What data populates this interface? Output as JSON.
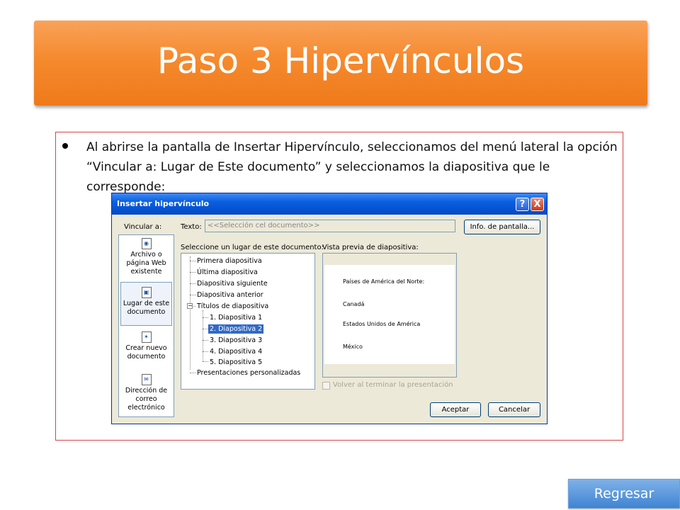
{
  "slide": {
    "title": "Paso 3 Hipervínculos",
    "bullet": "Al abrirse la pantalla de Insertar Hipervínculo, seleccionamos del menú lateral la opción “Vincular a: Lugar de Este documento” y seleccionamos la diapositiva que le corresponde:",
    "back_button": "Regresar"
  },
  "dialog": {
    "title": "Insertar hipervínculo",
    "help_glyph": "?",
    "close_glyph": "X",
    "link_to_label": "Vincular a:",
    "text_label": "Texto:",
    "text_value": "<<Selección cel documento>>",
    "screentip_button": "Info. de pantalla...",
    "select_place_label": "Seleccione un lugar de este documento:",
    "preview_label": "Vista previa de diapositiva:",
    "sidebar": [
      {
        "label": "Archivo o página Web existente",
        "icon": "web-page-icon"
      },
      {
        "label": "Lugar de este documento",
        "icon": "place-in-document-icon",
        "active": true
      },
      {
        "label": "Crear nuevo documento",
        "icon": "new-document-icon"
      },
      {
        "label": "Dirección de correo electrónico",
        "icon": "email-icon"
      }
    ],
    "tree": [
      "Primera diapositiva",
      "Última diapositiva",
      "Diapositiva siguiente",
      "Diapositiva anterior",
      "Títulos de diapositiva",
      "1. Diapositiva 1",
      "2. Diapositiva 2",
      "3. Diapositiva 3",
      "4. Diapositiva 4",
      "5. Diapositiva 5",
      "Presentaciones personalizadas"
    ],
    "tree_expander": "−",
    "preview_lines": [
      "Países de América del Norte:",
      "Canadá",
      "Estados Unidos de América",
      "México"
    ],
    "return_checkbox_label": "Volver al terminar la presentación",
    "ok_button": "Aceptar",
    "cancel_button": "Cancelar"
  },
  "colors": {
    "title_orange": "#f58a2e",
    "xp_titlebar": "#0a5fe0",
    "selection_blue": "#316ac5",
    "back_button_blue": "#4f8fd8",
    "box_border": "#d94545"
  }
}
